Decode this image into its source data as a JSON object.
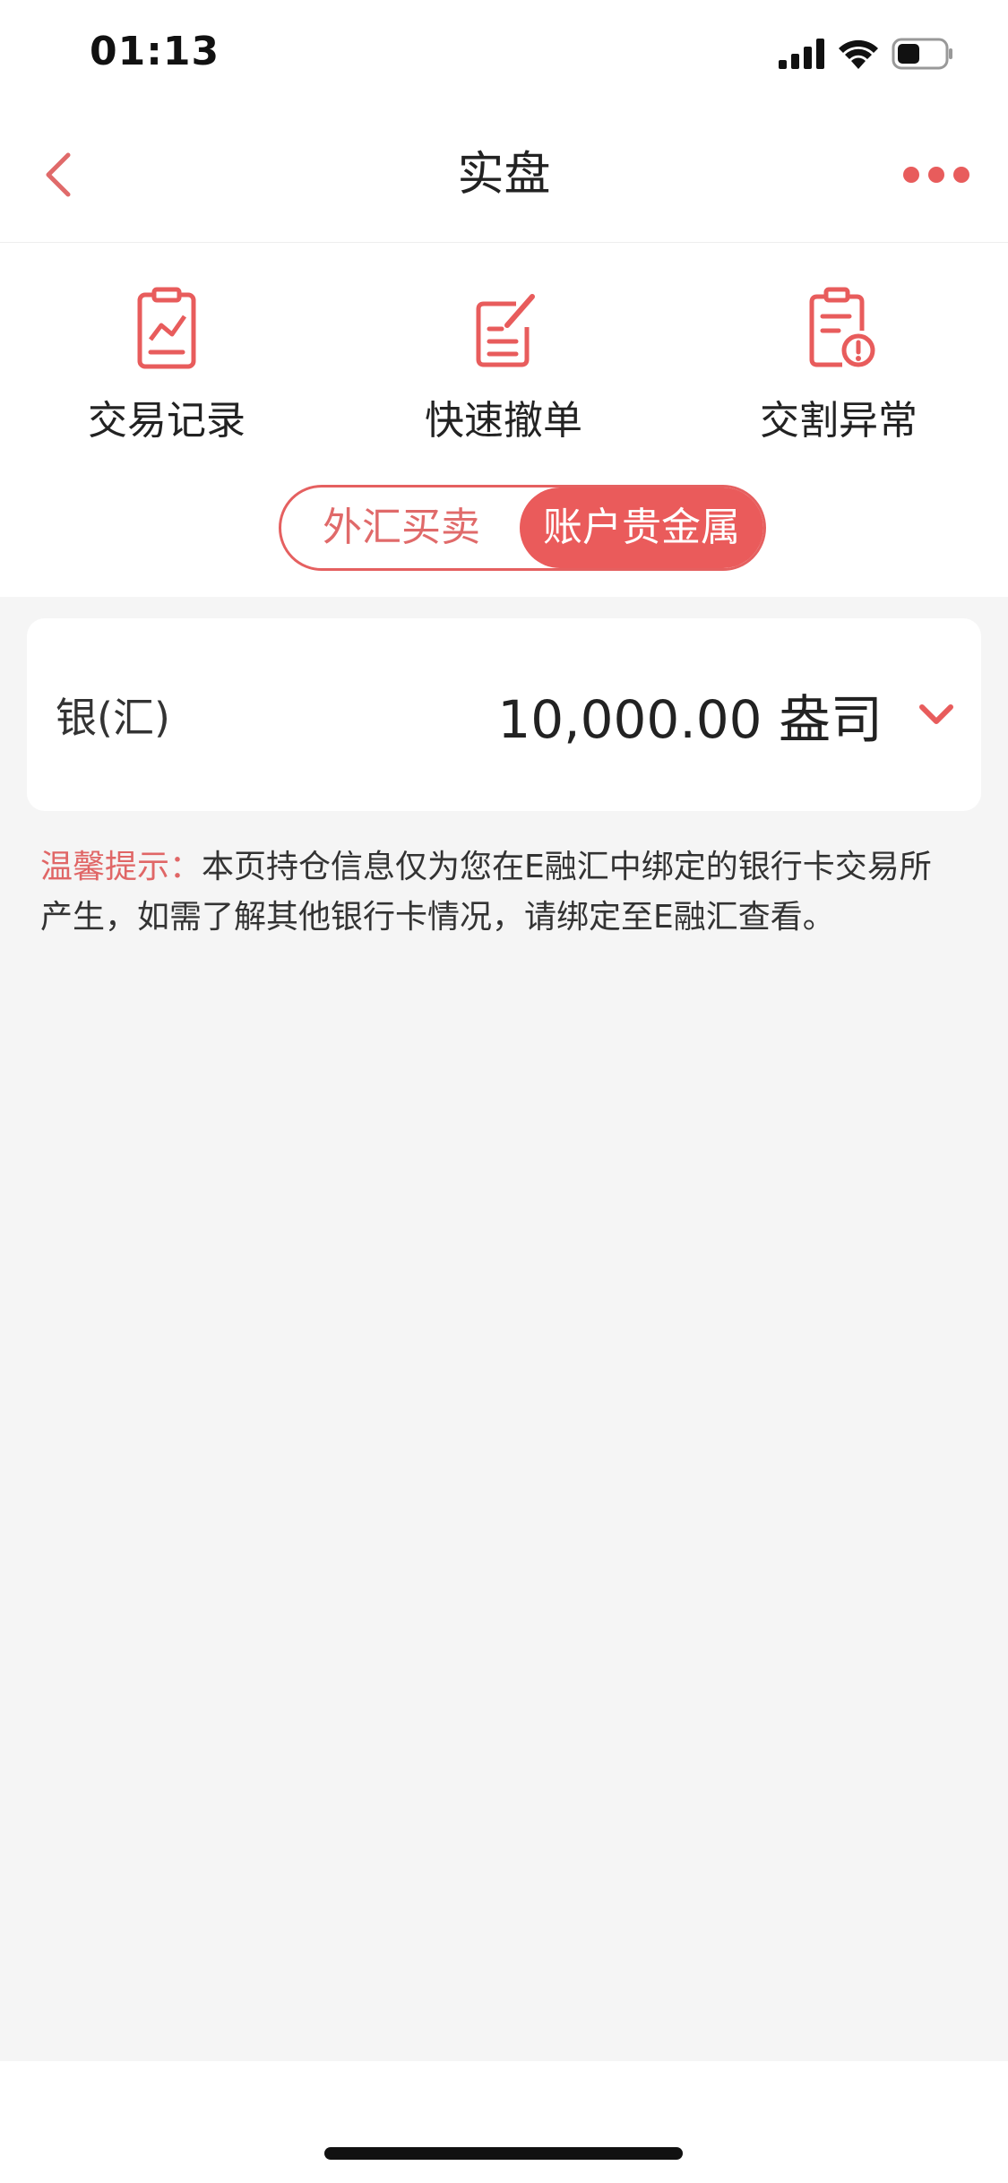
{
  "status_bar": {
    "time": "01:13"
  },
  "nav": {
    "title": "实盘"
  },
  "actions": [
    {
      "label": "交易记录",
      "icon": "chart-clipboard-icon"
    },
    {
      "label": "快速撤单",
      "icon": "edit-note-icon"
    },
    {
      "label": "交割异常",
      "icon": "clipboard-alert-icon"
    }
  ],
  "segment": {
    "options": [
      "外汇买卖",
      "账户贵金属"
    ],
    "selected": "账户贵金属"
  },
  "holding": {
    "name": "银(汇)",
    "amount": "10,000.00 盎司"
  },
  "notice": {
    "prefix": "温馨提示：",
    "text": "本页持仓信息仅为您在E融汇中绑定的银行卡交易所产生，如需了解其他银行卡情况，请绑定至E融汇查看。"
  },
  "colors": {
    "accent": "#e85c5c",
    "accent_text": "#e06a6a",
    "background": "#f5f5f5"
  }
}
